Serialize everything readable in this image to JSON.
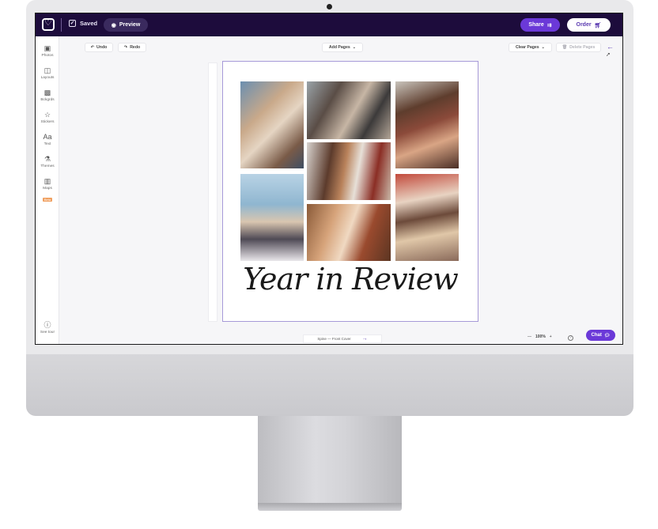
{
  "topbar": {
    "saved_label": "Saved",
    "preview_label": "Preview",
    "share_label": "Share",
    "order_label": "Order"
  },
  "sidebar": {
    "items": [
      {
        "label": "Photos",
        "icon": "photos-icon"
      },
      {
        "label": "Layouts",
        "icon": "layouts-icon"
      },
      {
        "label": "Bckgrds",
        "icon": "backgrounds-icon"
      },
      {
        "label": "Stickers",
        "icon": "stickers-icon"
      },
      {
        "label": "Text",
        "icon": "text-icon"
      },
      {
        "label": "Themes",
        "icon": "themes-icon"
      },
      {
        "label": "Maps",
        "icon": "maps-icon",
        "badge": "Beta"
      }
    ],
    "see_tour": "See tour"
  },
  "toolbar": {
    "undo": "Undo",
    "redo": "Redo",
    "add_pages": "Add Pages",
    "clear_pages": "Clear Pages",
    "delete_pages": "Delete Pages"
  },
  "cover": {
    "title": "Year in Review"
  },
  "footer": {
    "page_indicator": "Spine — Front Cover",
    "zoom": "100%"
  },
  "chat_label": "Chat",
  "colors": {
    "topbar": "#1d0c3c",
    "accent": "#6b39d8",
    "page_border": "#a79ad8"
  }
}
